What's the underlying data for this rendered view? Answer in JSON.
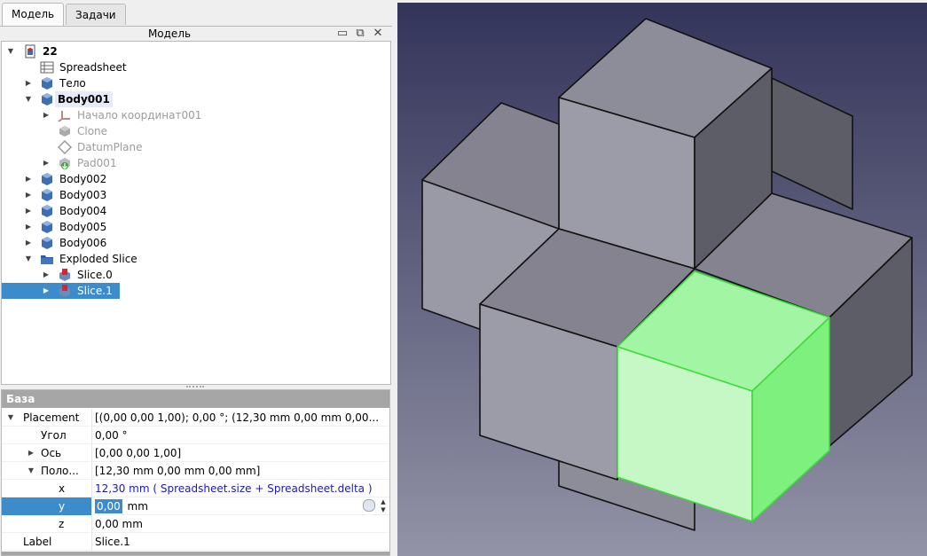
{
  "tabs": {
    "model": "Модель",
    "tasks": "Задачи"
  },
  "panel": {
    "title": "Модель"
  },
  "tree": {
    "doc": "22",
    "spreadsheet": "Spreadsheet",
    "telo": "Тело",
    "body001": "Body001",
    "origin": "Начало координат001",
    "clone": "Clone",
    "datum": "DatumPlane",
    "pad": "Pad001",
    "body002": "Body002",
    "body003": "Body003",
    "body004": "Body004",
    "body005": "Body005",
    "body006": "Body006",
    "exploded": "Exploded Slice",
    "slice0": "Slice.0",
    "slice1": "Slice.1"
  },
  "props": {
    "group": "База",
    "placement_name": "Placement",
    "placement_value": "[(0,00 0,00 1,00); 0,00 °; (12,30 mm  0,00 mm  0,00...",
    "angle_name": "Угол",
    "angle_value": "0,00 °",
    "axis_name": "Ось",
    "axis_value": "[0,00 0,00 1,00]",
    "pos_name": "Поло...",
    "pos_value": "[12,30 mm  0,00 mm  0,00 mm]",
    "x_name": "x",
    "x_value": "12,30 mm  ( Spreadsheet.size + Spreadsheet.delta )",
    "y_name": "y",
    "y_input": "0,00",
    "y_unit": "mm",
    "z_name": "z",
    "z_value": "0,00 mm",
    "label_name": "Label",
    "label_value": "Slice.1"
  },
  "colors": {
    "selection": "#3c8ccc",
    "highlight_green": "#7ef07e",
    "face_top": "#8a8a97",
    "face_left": "#9a99a6",
    "face_right": "#5d5d67"
  }
}
